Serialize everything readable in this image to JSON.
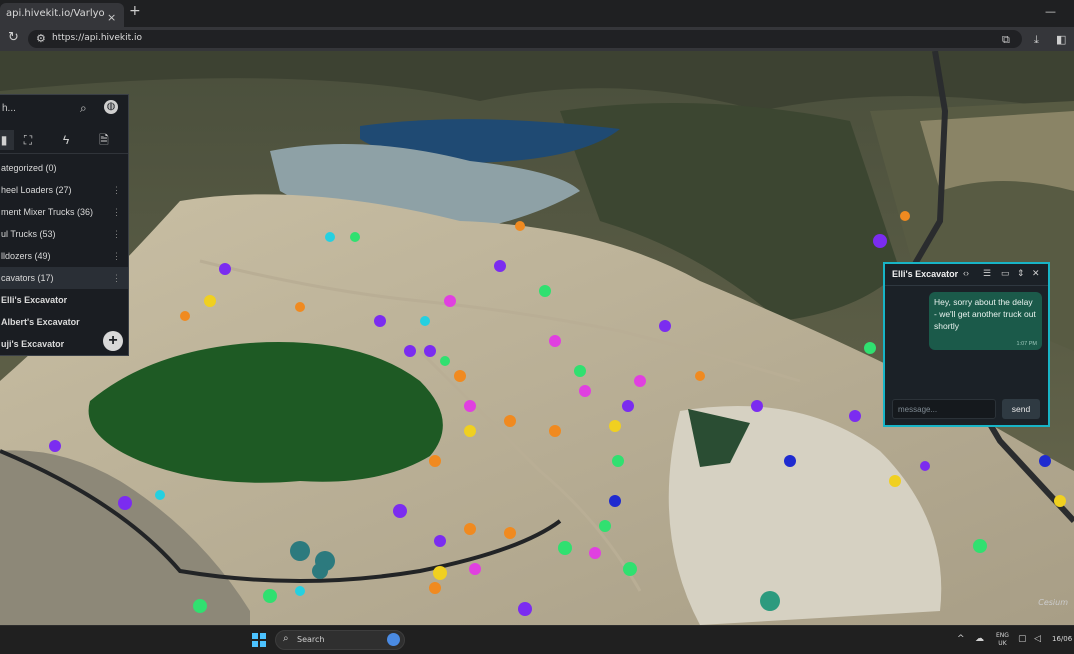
{
  "browser": {
    "tab_title": "api.hivekit.io/Varlyo",
    "tab_close": "×",
    "new_tab": "+",
    "window_minimize": "—",
    "url": "https://api.hivekit.io"
  },
  "side_panel": {
    "search_text": "h...",
    "search_icon": "search-icon",
    "tabs": [
      {
        "icon": "person-icon",
        "glyph": "👤"
      },
      {
        "icon": "polygon-icon",
        "glyph": "⛶"
      },
      {
        "icon": "lightning-icon",
        "glyph": "⚡"
      },
      {
        "icon": "document-icon",
        "glyph": "🗎"
      }
    ],
    "rows": [
      {
        "label": "ategorized (0)",
        "kebab": false
      },
      {
        "label": "heel Loaders (27)",
        "kebab": true
      },
      {
        "label": "ment Mixer Trucks (36)",
        "kebab": true
      },
      {
        "label": "ul Trucks (53)",
        "kebab": true
      },
      {
        "label": "lldozers (49)",
        "kebab": true
      },
      {
        "label": "cavators (17)",
        "kebab": true
      },
      {
        "label": "Elli's Excavator",
        "kebab": false
      },
      {
        "label": "Albert's Excavator",
        "kebab": false
      },
      {
        "label": "uji's Excavator",
        "kebab": false
      }
    ],
    "kebab_glyph": "⋮",
    "add_glyph": "+"
  },
  "chat": {
    "title": "Elli's Excavator",
    "message": "Hey, sorry about the delay - we'll get another truck out shortly",
    "time": "1:07 PM",
    "input_placeholder": "message...",
    "send_label": "send"
  },
  "taskbar": {
    "search_label": "Search",
    "lang_line1": "ENG",
    "lang_line2": "UK",
    "time": "16/06"
  },
  "colors": {
    "chat_border": "#18b4c6",
    "chat_bubble": "#1b5a4a",
    "panel_bg": "#1a1d22"
  }
}
